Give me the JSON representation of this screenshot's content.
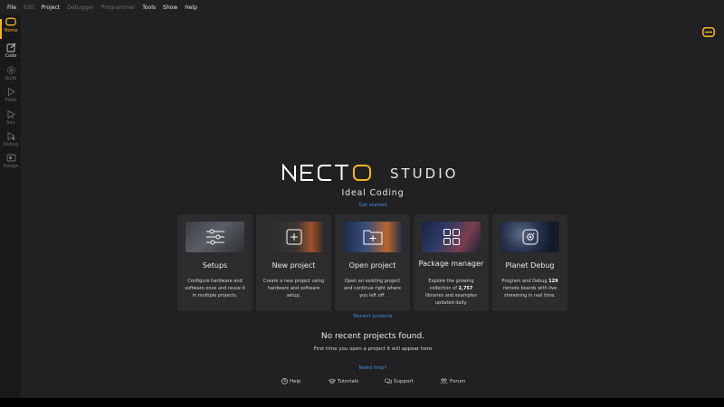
{
  "menu": [
    {
      "label": "File",
      "enabled": true
    },
    {
      "label": "Edit",
      "enabled": false
    },
    {
      "label": "Project",
      "enabled": true
    },
    {
      "label": "Debugger",
      "enabled": false
    },
    {
      "label": "Programmer",
      "enabled": false
    },
    {
      "label": "Tools",
      "enabled": true
    },
    {
      "label": "Show",
      "enabled": true
    },
    {
      "label": "Help",
      "enabled": true
    }
  ],
  "sidebar": {
    "items": [
      {
        "label": "Home",
        "icon": "home-icon",
        "state": "active"
      },
      {
        "label": "Code",
        "icon": "edit-icon",
        "state": "enabled"
      },
      {
        "label": "Build",
        "icon": "gear-icon",
        "state": "disabled"
      },
      {
        "label": "Flash",
        "icon": "play-icon",
        "state": "disabled"
      },
      {
        "label": "Sim",
        "icon": "sim-icon",
        "state": "disabled"
      },
      {
        "label": "Debug",
        "icon": "debug-icon",
        "state": "disabled"
      },
      {
        "label": "Design",
        "icon": "design-icon",
        "state": "disabled"
      }
    ]
  },
  "brand": {
    "logo_main": "NECTO",
    "logo_studio": "STUDIO",
    "tagline": "Ideal Coding",
    "accent": "#f2b526"
  },
  "links": {
    "get_started": "Get started",
    "recent_projects": "Recent projects",
    "need_help": "Need help?"
  },
  "cards": [
    {
      "title": "Setups",
      "icon": "sliders-icon",
      "desc": "Configure hardware and software once and reuse it in multiple projects."
    },
    {
      "title": "New project",
      "icon": "plus-box-icon",
      "desc": "Create a new project using hardware and software setup."
    },
    {
      "title": "Open project",
      "icon": "open-folder-icon",
      "desc": "Open an existing project and continue right where you left off."
    },
    {
      "title": "Package manager",
      "icon": "package-icon",
      "desc_pre": "Explore the growing collection of ",
      "desc_bold": "2,757",
      "desc_post": " libraries and examples updated daily."
    },
    {
      "title": "Planet Debug",
      "icon": "planet-debug-icon",
      "desc_pre": "Program and Debug ",
      "desc_bold": "129",
      "desc_post": " remote boards with live streaming in real time."
    }
  ],
  "recent": {
    "empty_title": "No recent projects found.",
    "empty_hint": "First time you open a project it will appear here"
  },
  "footer": [
    {
      "label": "Help",
      "icon": "help-circle-icon"
    },
    {
      "label": "Tutorials",
      "icon": "graduation-cap-icon"
    },
    {
      "label": "Support",
      "icon": "chat-icon"
    },
    {
      "label": "Forum",
      "icon": "users-icon"
    }
  ]
}
